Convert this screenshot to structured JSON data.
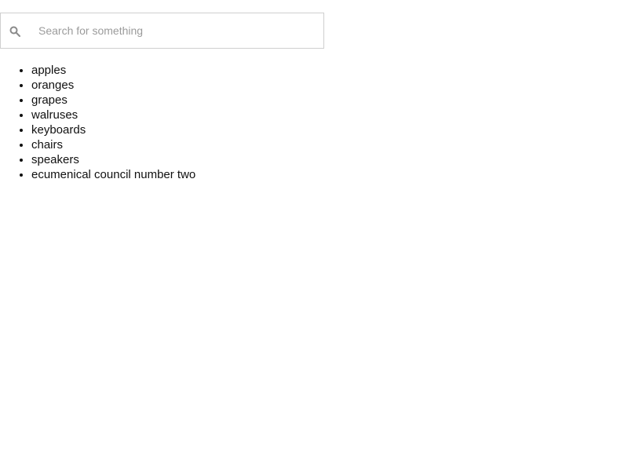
{
  "search": {
    "placeholder": "Search for something",
    "value": "",
    "icon": "search-icon"
  },
  "list": {
    "items": [
      "apples",
      "oranges",
      "grapes",
      "walruses",
      "keyboards",
      "chairs",
      "speakers",
      "ecumenical council number two"
    ]
  },
  "colors": {
    "border": "#cfcfcf",
    "placeholder": "#9b9b9b",
    "icon": "#8a8a8a",
    "text": "#111111"
  }
}
